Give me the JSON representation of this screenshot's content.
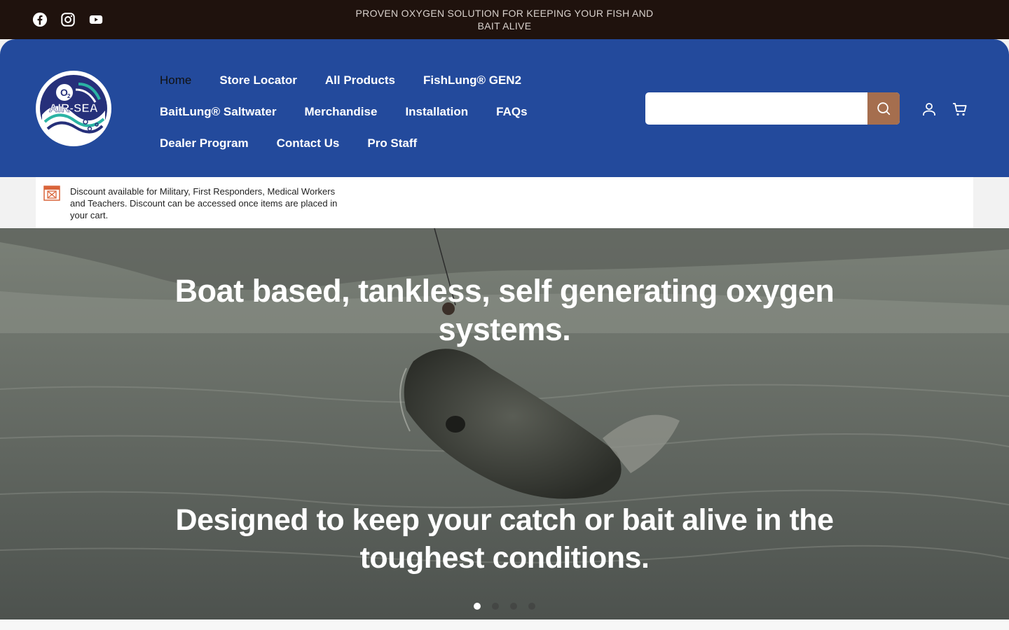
{
  "announcement": "PROVEN OXYGEN SOLUTION FOR KEEPING YOUR FISH AND BAIT ALIVE",
  "social": [
    {
      "icon": "facebook-icon"
    },
    {
      "icon": "instagram-icon"
    },
    {
      "icon": "youtube-icon"
    }
  ],
  "logo": {
    "o2": "O",
    "o2_sub": "2",
    "text": "AIR-SEA"
  },
  "nav": {
    "row1": [
      "Home",
      "Store Locator",
      "All Products",
      "FishLung® GEN2"
    ],
    "row2": [
      "BaitLung® Saltwater",
      "Merchandise",
      "Installation",
      "FAQs"
    ],
    "row3": [
      "Dealer Program",
      "Contact Us",
      "Pro Staff"
    ],
    "active": "Home"
  },
  "search": {
    "placeholder": "",
    "value": "",
    "icon": "search-icon"
  },
  "header_icons": {
    "account": "account-icon",
    "cart": "cart-icon"
  },
  "notice": {
    "text": "Discount available for Military, First Responders, Medical Workers and Teachers. Discount can be accessed once items are placed in your cart.",
    "icon": "discount-icon"
  },
  "hero": {
    "title": "Boat based, tankless, self generating oxygen systems.",
    "subtitle": "Designed to keep your catch or bait alive in the toughest conditions.",
    "slides": 4,
    "active_slide": 1
  },
  "colors": {
    "topbar": "#1f120d",
    "header": "#234a9c",
    "search_button": "#a56e4e"
  }
}
